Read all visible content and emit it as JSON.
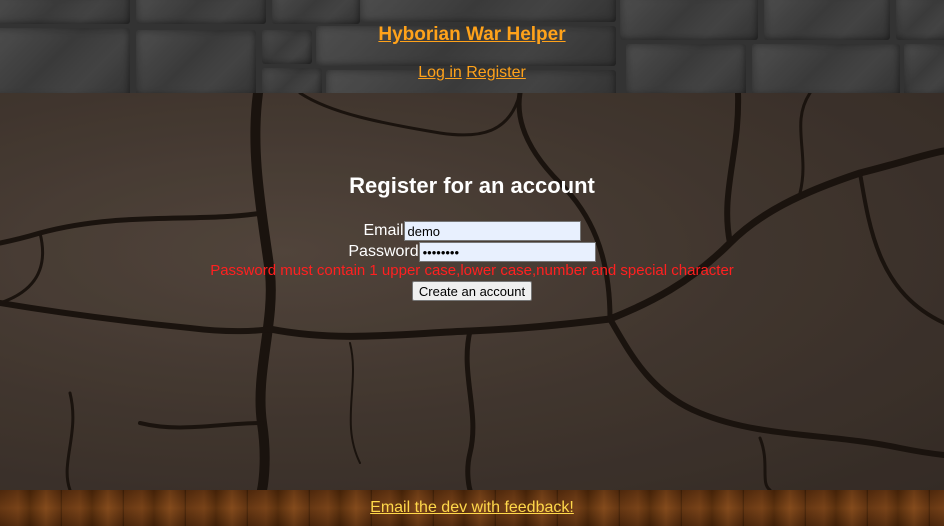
{
  "header": {
    "title": "Hyborian War Helper",
    "nav": {
      "login_label": "Log in",
      "register_label": "Register"
    }
  },
  "form": {
    "title": "Register for an account",
    "email_label": "Email",
    "email_value": "demo",
    "password_label": "Password",
    "password_value": "••••••••",
    "error_message": "Password must contain 1 upper case,lower case,number and special character",
    "submit_label": "Create an account"
  },
  "footer": {
    "feedback_label": "Email the dev with feedback!"
  },
  "colors": {
    "link_orange": "#ffa21a",
    "error_red": "#ff2020",
    "footer_link": "#ffd84a"
  }
}
